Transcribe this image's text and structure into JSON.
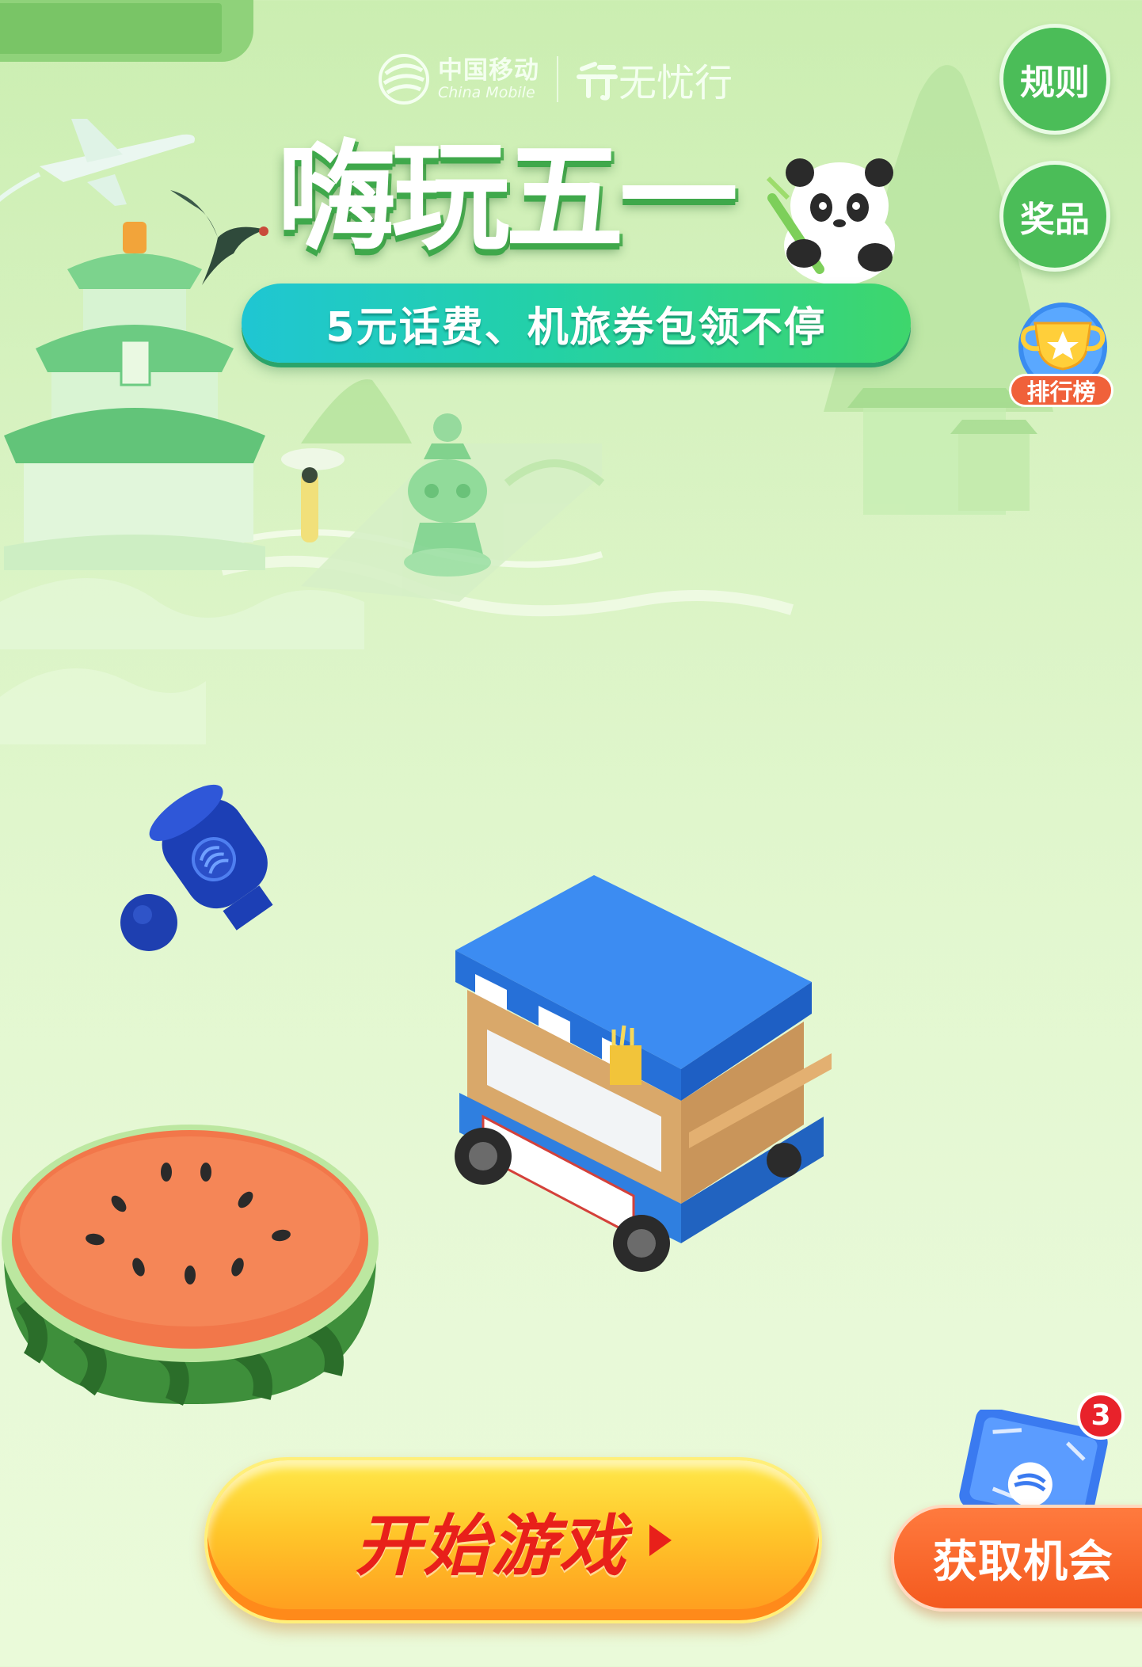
{
  "header": {
    "brand_cn": "中国移动",
    "brand_en": "China Mobile",
    "partner_name": "无忧行",
    "partner_mark": "行"
  },
  "banner": {
    "title": "嗨玩五一",
    "subtitle": "5元话费、机旅券包领不停"
  },
  "side_buttons": {
    "rules": "规则",
    "prizes": "奖品",
    "leaderboard": "排行榜"
  },
  "actions": {
    "start_game": "开始游戏",
    "get_chance": "获取机会",
    "chance_count": "3"
  },
  "colors": {
    "bg_top": "#cbeeb1",
    "bg_bottom": "#eafad9",
    "accent_green": "#4bbd58",
    "banner_teal": "#1fc6d3",
    "start_red": "#e8201a",
    "chance_orange": "#f45a1f"
  },
  "icons": {
    "brand_logo": "china-mobile-logo-icon",
    "partner_logo": "wuyouxing-logo-icon",
    "leaderboard_trophy": "trophy-icon",
    "game_item_1": "blue-tool-item-icon",
    "game_item_2": "food-cart-icon",
    "game_item_3": "watermelon-icon",
    "chance_ticket": "ticket-card-icon"
  }
}
